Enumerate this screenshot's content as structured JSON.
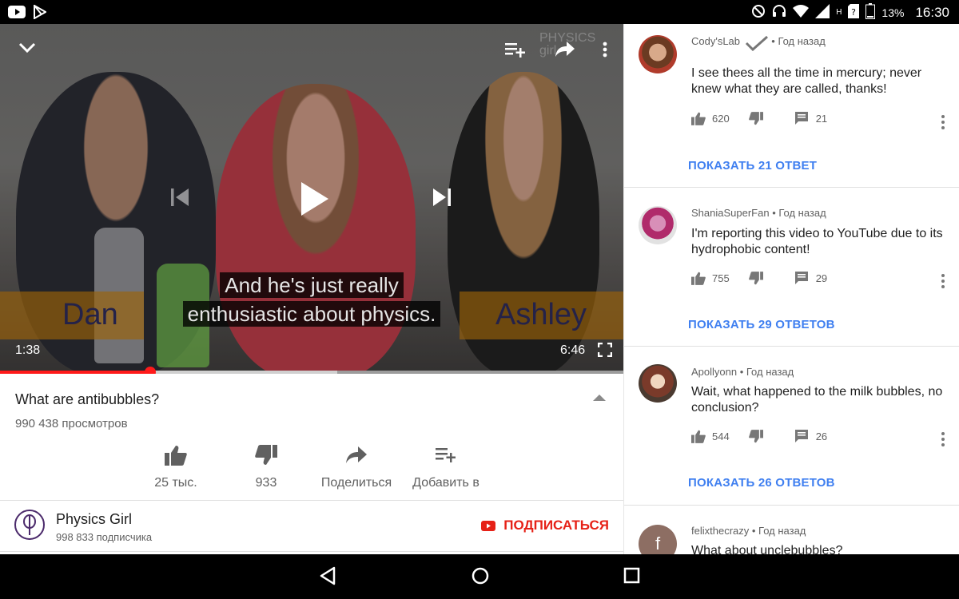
{
  "status_bar": {
    "time": "16:30",
    "battery_percent": "13%",
    "network": "H",
    "icons_left": [
      "youtube-icon",
      "play-store-icon"
    ],
    "icons_right": [
      "do-not-disturb-icon",
      "headset-icon",
      "wifi-icon",
      "signal-icon",
      "sim-unknown-icon",
      "battery-icon"
    ]
  },
  "video": {
    "subtitle_line1": "And he's just really",
    "subtitle_line2": "enthusiastic about physics.",
    "name_left": "Dan",
    "name_right": "Ashley",
    "watermark": "PHYSICS girl",
    "current_time": "1:38",
    "duration": "6:46",
    "progress": 0.241,
    "buffered": 0.541
  },
  "info": {
    "title": "What are antibubbles?",
    "views": "990 438 просмотров",
    "actions": [
      {
        "label": "25 тыс.",
        "icon": "thumb-up-icon"
      },
      {
        "label": "933",
        "icon": "thumb-down-icon"
      },
      {
        "label": "Поделиться",
        "icon": "share-icon"
      },
      {
        "label": "Добавить в",
        "icon": "playlist-add-icon"
      }
    ],
    "channel": {
      "name": "Physics Girl",
      "subscribers": "998 833 подписчика",
      "subscribe_label": "ПОДПИСАТЬСЯ"
    }
  },
  "comments": [
    {
      "author": "Cody'sLab",
      "time": "Год назад",
      "text": "I see thees all the time in mercury; never knew what they are called, thanks!",
      "likes": "620",
      "replies": "21",
      "show_replies": "ПОКАЗАТЬ 21 ОТВЕТ"
    },
    {
      "author": "ShaniaSuperFan",
      "time": "Год назад",
      "text": "I'm reporting this video to YouTube due to its hydrophobic content!",
      "likes": "755",
      "replies": "29",
      "show_replies": "ПОКАЗАТЬ 29 ОТВЕТОВ"
    },
    {
      "author": "Apollyonn",
      "time": "Год назад",
      "text": "Wait, what happened to the milk bubbles, no conclusion?",
      "likes": "544",
      "replies": "26",
      "show_replies": "ПОКАЗАТЬ 26 ОТВЕТОВ"
    },
    {
      "author": "felixthecrazy",
      "time": "Год назад",
      "text": "What about unclebubbles?",
      "avatar_letter": "f"
    }
  ],
  "colors": {
    "accent_red": "#e62117",
    "link_blue": "#3f7ff0",
    "progress_red": "#ff1a1a"
  }
}
